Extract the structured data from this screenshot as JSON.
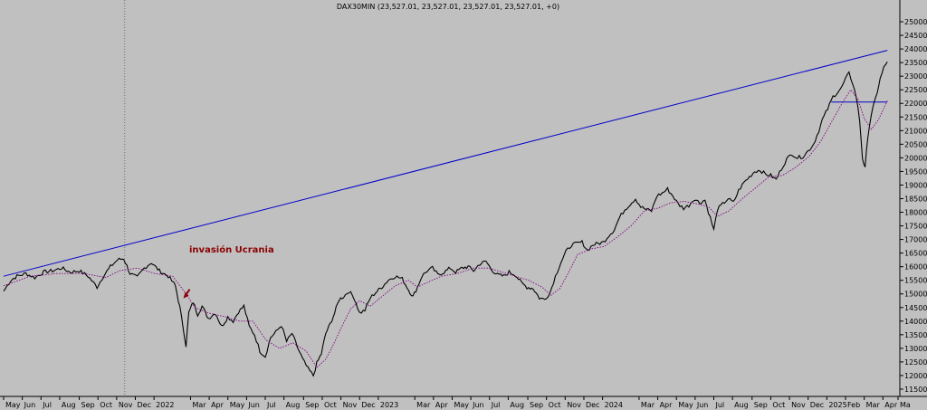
{
  "chart_data": {
    "type": "line",
    "title": "DAX30MIN (23,527.01, 23,527.01, 23,527.01, 23,527.01, +0)",
    "ylim": [
      11000,
      25500
    ],
    "y_ticks": [
      11500,
      12000,
      12500,
      13000,
      13500,
      14000,
      14500,
      15000,
      15500,
      16000,
      16500,
      17000,
      17500,
      18000,
      18500,
      19000,
      19500,
      20000,
      20500,
      21000,
      21500,
      22000,
      22500,
      23000,
      23500,
      24000,
      24500,
      25000
    ],
    "x_ticks": [
      "May",
      "Jun",
      "Jul",
      "Aug",
      "Sep",
      "Oct",
      "Nov",
      "Dec",
      "2022",
      "Mar",
      "Apr",
      "May",
      "Jun",
      "Jul",
      "Aug",
      "Sep",
      "Oct",
      "Nov",
      "Dec",
      "2023",
      "Mar",
      "Apr",
      "May",
      "Jun",
      "Jul",
      "Aug",
      "Sep",
      "Oct",
      "Nov",
      "Dec",
      "2024",
      "Mar",
      "Apr",
      "May",
      "Jun",
      "Jul",
      "Aug",
      "Sep",
      "Oct",
      "Nov",
      "Dec",
      "2025",
      "Feb",
      "Mar",
      "Apr",
      "Ma"
    ],
    "x_tick_index": [
      0,
      21,
      42,
      63,
      85,
      106,
      127,
      148,
      169,
      210,
      231,
      252,
      273,
      294,
      315,
      337,
      358,
      379,
      400,
      421,
      462,
      483,
      504,
      525,
      546,
      567,
      589,
      610,
      631,
      652,
      673,
      714,
      735,
      756,
      777,
      798,
      819,
      841,
      862,
      883,
      904,
      925,
      946,
      967,
      988,
      1005
    ],
    "series": [
      {
        "key": "price",
        "color": "#000000",
        "points": [
          [
            0,
            15100
          ],
          [
            8,
            15500
          ],
          [
            15,
            15650
          ],
          [
            25,
            15750
          ],
          [
            35,
            15600
          ],
          [
            45,
            15800
          ],
          [
            55,
            15850
          ],
          [
            65,
            15950
          ],
          [
            75,
            15800
          ],
          [
            85,
            15850
          ],
          [
            95,
            15650
          ],
          [
            105,
            15250
          ],
          [
            112,
            15650
          ],
          [
            120,
            16000
          ],
          [
            128,
            16250
          ],
          [
            135,
            16300
          ],
          [
            142,
            15750
          ],
          [
            150,
            15600
          ],
          [
            158,
            15950
          ],
          [
            166,
            16150
          ],
          [
            175,
            15850
          ],
          [
            185,
            15650
          ],
          [
            193,
            15300
          ],
          [
            198,
            14500
          ],
          [
            202,
            13700
          ],
          [
            205,
            13100
          ],
          [
            208,
            14300
          ],
          [
            213,
            14700
          ],
          [
            218,
            14250
          ],
          [
            223,
            14550
          ],
          [
            230,
            14100
          ],
          [
            238,
            14300
          ],
          [
            245,
            13800
          ],
          [
            252,
            14150
          ],
          [
            258,
            14000
          ],
          [
            264,
            14350
          ],
          [
            270,
            14550
          ],
          [
            276,
            13800
          ],
          [
            282,
            13500
          ],
          [
            288,
            12900
          ],
          [
            294,
            12700
          ],
          [
            300,
            13400
          ],
          [
            306,
            13600
          ],
          [
            312,
            13850
          ],
          [
            318,
            13250
          ],
          [
            324,
            13550
          ],
          [
            330,
            13050
          ],
          [
            336,
            12600
          ],
          [
            342,
            12250
          ],
          [
            348,
            12000
          ],
          [
            352,
            12450
          ],
          [
            357,
            12800
          ],
          [
            362,
            13550
          ],
          [
            367,
            13900
          ],
          [
            372,
            14300
          ],
          [
            377,
            14800
          ],
          [
            382,
            14900
          ],
          [
            388,
            15100
          ],
          [
            394,
            14850
          ],
          [
            400,
            14300
          ],
          [
            406,
            14400
          ],
          [
            412,
            14850
          ],
          [
            418,
            15050
          ],
          [
            425,
            15250
          ],
          [
            432,
            15500
          ],
          [
            440,
            15650
          ],
          [
            448,
            15550
          ],
          [
            455,
            15150
          ],
          [
            460,
            14900
          ],
          [
            465,
            15250
          ],
          [
            470,
            15650
          ],
          [
            476,
            15850
          ],
          [
            482,
            15950
          ],
          [
            488,
            15700
          ],
          [
            495,
            15800
          ],
          [
            502,
            15950
          ],
          [
            508,
            15800
          ],
          [
            515,
            15950
          ],
          [
            522,
            16000
          ],
          [
            528,
            15850
          ],
          [
            535,
            16100
          ],
          [
            542,
            16200
          ],
          [
            548,
            15900
          ],
          [
            555,
            15700
          ],
          [
            562,
            15650
          ],
          [
            568,
            15800
          ],
          [
            575,
            15700
          ],
          [
            582,
            15400
          ],
          [
            588,
            15250
          ],
          [
            595,
            15200
          ],
          [
            602,
            14850
          ],
          [
            608,
            14800
          ],
          [
            614,
            15050
          ],
          [
            620,
            15650
          ],
          [
            626,
            16150
          ],
          [
            632,
            16550
          ],
          [
            638,
            16800
          ],
          [
            644,
            16850
          ],
          [
            650,
            16900
          ],
          [
            656,
            16600
          ],
          [
            662,
            16800
          ],
          [
            668,
            16850
          ],
          [
            674,
            16900
          ],
          [
            680,
            17150
          ],
          [
            686,
            17350
          ],
          [
            692,
            17800
          ],
          [
            698,
            18100
          ],
          [
            704,
            18300
          ],
          [
            710,
            18500
          ],
          [
            716,
            18200
          ],
          [
            722,
            18100
          ],
          [
            728,
            18050
          ],
          [
            734,
            18600
          ],
          [
            740,
            18700
          ],
          [
            746,
            18850
          ],
          [
            752,
            18600
          ],
          [
            758,
            18300
          ],
          [
            764,
            18150
          ],
          [
            770,
            18250
          ],
          [
            776,
            18500
          ],
          [
            782,
            18350
          ],
          [
            788,
            18450
          ],
          [
            794,
            17800
          ],
          [
            798,
            17350
          ],
          [
            802,
            18100
          ],
          [
            808,
            18300
          ],
          [
            814,
            18500
          ],
          [
            820,
            18350
          ],
          [
            826,
            18800
          ],
          [
            832,
            19100
          ],
          [
            838,
            19300
          ],
          [
            844,
            19500
          ],
          [
            850,
            19550
          ],
          [
            856,
            19400
          ],
          [
            862,
            19350
          ],
          [
            868,
            19200
          ],
          [
            874,
            19600
          ],
          [
            880,
            19950
          ],
          [
            886,
            20150
          ],
          [
            892,
            20000
          ],
          [
            898,
            20050
          ],
          [
            904,
            20250
          ],
          [
            910,
            20500
          ],
          [
            916,
            21000
          ],
          [
            920,
            21400
          ],
          [
            926,
            21800
          ],
          [
            932,
            22250
          ],
          [
            938,
            22450
          ],
          [
            942,
            22600
          ],
          [
            946,
            22900
          ],
          [
            950,
            23100
          ],
          [
            954,
            22750
          ],
          [
            958,
            22250
          ],
          [
            962,
            21350
          ],
          [
            965,
            20000
          ],
          [
            968,
            19600
          ],
          [
            971,
            20800
          ],
          [
            975,
            21600
          ],
          [
            980,
            22200
          ],
          [
            985,
            22900
          ],
          [
            989,
            23300
          ],
          [
            993,
            23527
          ]
        ]
      },
      {
        "key": "moving-average",
        "color": "#800080",
        "points": [
          [
            0,
            15300
          ],
          [
            30,
            15650
          ],
          [
            60,
            15750
          ],
          [
            90,
            15750
          ],
          [
            115,
            15600
          ],
          [
            130,
            15850
          ],
          [
            150,
            15950
          ],
          [
            170,
            15750
          ],
          [
            190,
            15650
          ],
          [
            205,
            15000
          ],
          [
            215,
            14500
          ],
          [
            230,
            14300
          ],
          [
            250,
            14150
          ],
          [
            265,
            14000
          ],
          [
            280,
            14000
          ],
          [
            295,
            13300
          ],
          [
            310,
            13000
          ],
          [
            325,
            13200
          ],
          [
            340,
            12900
          ],
          [
            352,
            12300
          ],
          [
            362,
            12600
          ],
          [
            370,
            13100
          ],
          [
            380,
            13800
          ],
          [
            390,
            14450
          ],
          [
            400,
            14750
          ],
          [
            412,
            14550
          ],
          [
            425,
            14900
          ],
          [
            440,
            15300
          ],
          [
            455,
            15500
          ],
          [
            465,
            15250
          ],
          [
            478,
            15450
          ],
          [
            492,
            15650
          ],
          [
            510,
            15750
          ],
          [
            528,
            15950
          ],
          [
            545,
            15950
          ],
          [
            560,
            15800
          ],
          [
            575,
            15650
          ],
          [
            590,
            15500
          ],
          [
            605,
            15250
          ],
          [
            615,
            14950
          ],
          [
            625,
            15200
          ],
          [
            635,
            15800
          ],
          [
            645,
            16450
          ],
          [
            660,
            16650
          ],
          [
            675,
            16750
          ],
          [
            690,
            17100
          ],
          [
            705,
            17500
          ],
          [
            720,
            18050
          ],
          [
            735,
            18150
          ],
          [
            750,
            18350
          ],
          [
            765,
            18400
          ],
          [
            780,
            18300
          ],
          [
            792,
            18200
          ],
          [
            802,
            17850
          ],
          [
            815,
            18050
          ],
          [
            830,
            18500
          ],
          [
            845,
            18900
          ],
          [
            860,
            19300
          ],
          [
            875,
            19350
          ],
          [
            890,
            19650
          ],
          [
            905,
            20050
          ],
          [
            918,
            20600
          ],
          [
            930,
            21300
          ],
          [
            942,
            22000
          ],
          [
            952,
            22500
          ],
          [
            960,
            22150
          ],
          [
            967,
            21450
          ],
          [
            975,
            21050
          ],
          [
            983,
            21400
          ],
          [
            993,
            22100
          ]
        ]
      }
    ],
    "trendlines": [
      {
        "key": "upper-trendline",
        "color": "#0000cc",
        "from": [
          0,
          15650
        ],
        "to": [
          993,
          23950
        ]
      },
      {
        "key": "support-line",
        "color": "#0000cc",
        "from": [
          930,
          22050
        ],
        "to": [
          993,
          22050
        ]
      }
    ],
    "vertical_line_index": 136,
    "annotation": {
      "text": "invasión Ucrania",
      "color": "#8b0000",
      "target": [
        203,
        14900
      ]
    }
  }
}
